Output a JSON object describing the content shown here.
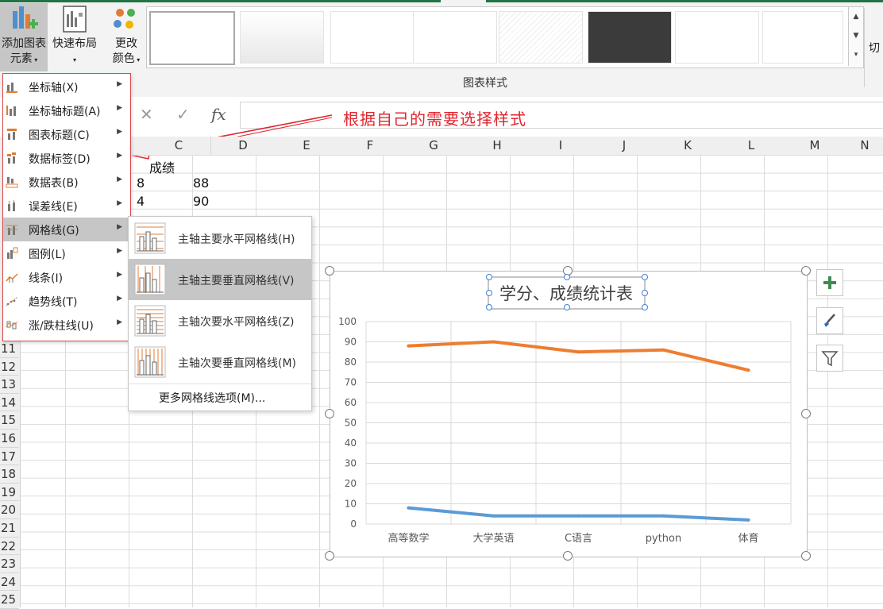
{
  "ribbon": {
    "add_chart_element_line1": "添加图表",
    "add_chart_element_line2": "元素",
    "quick_layout": "快速布局",
    "change_colors_line1": "更改",
    "change_colors_line2": "颜色",
    "group_label": "图表样式",
    "right_cut_label": "切",
    "style_count": 8
  },
  "formula_bar": {
    "cancel_icon": "✕",
    "enter_icon": "✓",
    "fx_icon": "fx",
    "value": ""
  },
  "annotation": {
    "text": "根据自己的需要选择样式",
    "color": "#e0262f"
  },
  "sheet": {
    "columns": [
      "C",
      "D",
      "E",
      "F",
      "G",
      "H",
      "I",
      "J",
      "K",
      "L",
      "M",
      "N"
    ],
    "rows": [
      "11",
      "12",
      "13",
      "14",
      "15",
      "16",
      "17",
      "18",
      "19",
      "20",
      "21",
      "22",
      "23",
      "24",
      "25"
    ],
    "cells": {
      "c1": "成绩",
      "b2": "8",
      "c2": "88",
      "b3": "4",
      "c3": "90"
    }
  },
  "menu": {
    "items": [
      {
        "label": "坐标轴(X)",
        "icon": "axes-icon"
      },
      {
        "label": "坐标轴标题(A)",
        "icon": "axis-titles-icon"
      },
      {
        "label": "图表标题(C)",
        "icon": "chart-title-icon"
      },
      {
        "label": "数据标签(D)",
        "icon": "data-labels-icon"
      },
      {
        "label": "数据表(B)",
        "icon": "data-table-icon"
      },
      {
        "label": "误差线(E)",
        "icon": "error-bars-icon"
      },
      {
        "label": "网格线(G)",
        "icon": "gridlines-icon"
      },
      {
        "label": "图例(L)",
        "icon": "legend-icon"
      },
      {
        "label": "线条(I)",
        "icon": "lines-icon"
      },
      {
        "label": "趋势线(T)",
        "icon": "trendline-icon"
      },
      {
        "label": "涨/跌柱线(U)",
        "icon": "up-down-bars-icon"
      }
    ],
    "active_index": 6
  },
  "submenu": {
    "items": [
      {
        "label": "主轴主要水平网格线(H)",
        "icon": "primary-major-horizontal-gridlines-icon"
      },
      {
        "label": "主轴主要垂直网格线(V)",
        "icon": "primary-major-vertical-gridlines-icon"
      },
      {
        "label": "主轴次要水平网格线(Z)",
        "icon": "primary-minor-horizontal-gridlines-icon"
      },
      {
        "label": "主轴次要垂直网格线(M)",
        "icon": "primary-minor-vertical-gridlines-icon"
      }
    ],
    "more": "更多网格线选项(M)...",
    "active_index": 1
  },
  "chart_data": {
    "type": "line",
    "title": "学分、成绩统计表",
    "categories": [
      "高等数学",
      "大学英语",
      "C语言",
      "python",
      "体育"
    ],
    "series": [
      {
        "values": [
          88,
          90,
          85,
          86,
          76
        ],
        "color": "#ed7d31"
      },
      {
        "values": [
          8,
          4,
          4,
          4,
          2
        ],
        "color": "#5b9bd5"
      }
    ],
    "ylim": [
      0,
      100
    ],
    "yticks": [
      "0",
      "10",
      "20",
      "30",
      "40",
      "50",
      "60",
      "70",
      "80",
      "90",
      "100"
    ],
    "grid": "horizontal and vertical major gridlines",
    "legend": "none"
  },
  "chart_side_buttons": [
    {
      "name": "chart-elements-button",
      "icon": "plus-icon"
    },
    {
      "name": "chart-styles-button",
      "icon": "paintbrush-icon"
    },
    {
      "name": "chart-filters-button",
      "icon": "funnel-icon"
    }
  ]
}
